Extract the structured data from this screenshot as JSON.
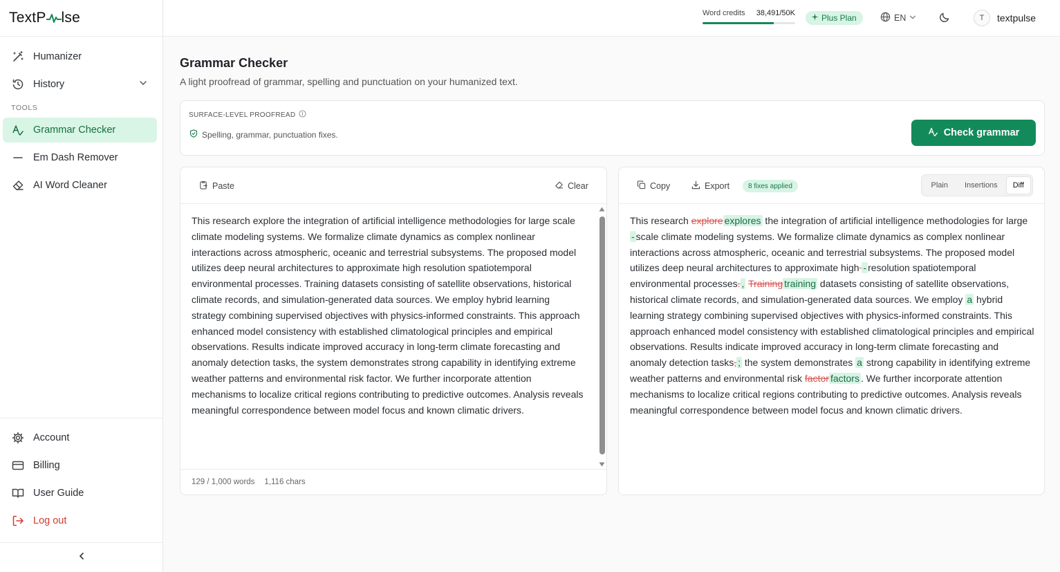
{
  "brand": {
    "name_prefix": "TextP",
    "name_suffix": "lse"
  },
  "sidebar": {
    "main_items": [
      {
        "label": "Humanizer"
      },
      {
        "label": "History"
      }
    ],
    "tools_label": "TOOLS",
    "tool_items": [
      {
        "label": "Grammar Checker",
        "active": true
      },
      {
        "label": "Em Dash Remover"
      },
      {
        "label": "AI Word Cleaner"
      }
    ],
    "bottom_items": [
      {
        "label": "Account"
      },
      {
        "label": "Billing"
      },
      {
        "label": "User Guide"
      },
      {
        "label": "Log out"
      }
    ]
  },
  "header": {
    "credits_label": "Word credits",
    "credits_value": "38,491/50K",
    "credits_fraction": 0.77,
    "plan": "Plus Plan",
    "language": "EN",
    "avatar_initial": "T",
    "username": "textpulse"
  },
  "page": {
    "title": "Grammar Checker",
    "subtitle": "A light proofread of grammar, spelling and punctuation on your humanized text."
  },
  "proof": {
    "label": "SURFACE-LEVEL PROOFREAD",
    "note": "Spelling, grammar, punctuation fixes.",
    "button": "Check grammar"
  },
  "input_panel": {
    "paste": "Paste",
    "clear": "Clear",
    "text": "This research explore the integration of artificial intelligence methodologies for large scale climate modeling systems. We formalize climate dynamics as complex nonlinear interactions across atmospheric, oceanic and terrestrial subsystems. The proposed model utilizes deep neural architectures to approximate high resolution spatiotemporal environmental processes. Training datasets consisting of satellite observations, historical climate records, and simulation-generated data sources. We employ hybrid learning strategy combining supervised objectives with physics-informed constraints. This approach enhanced model consistency with established climatological principles and empirical observations. Results indicate improved accuracy in long-term climate forecasting and anomaly detection tasks, the system demonstrates strong capability in identifying extreme weather patterns and environmental risk factor. We further incorporate attention mechanisms to localize critical regions contributing to predictive outcomes. Analysis reveals meaningful correspondence between model focus and known climatic drivers.",
    "word_count": "129 / 1,000 words",
    "char_count": "1,116 chars"
  },
  "output_panel": {
    "copy": "Copy",
    "export": "Export",
    "fixes_badge": "8 fixes applied",
    "views": [
      "Plain",
      "Insertions",
      "Diff"
    ],
    "active_view": "Diff",
    "segments": [
      {
        "t": "This research "
      },
      {
        "t": "explore",
        "type": "del"
      },
      {
        "t": "explores",
        "type": "ins"
      },
      {
        "t": " the integration of artificial intelligence methodologies for large"
      },
      {
        "t": " ",
        "type": "del"
      },
      {
        "t": "-",
        "type": "ins"
      },
      {
        "t": "scale climate modeling systems. We formalize climate dynamics as complex nonlinear interactions across atmospheric, oceanic and terrestrial subsystems. The proposed model utilizes deep neural architectures to approximate high"
      },
      {
        "t": " ",
        "type": "del"
      },
      {
        "t": "-",
        "type": "ins"
      },
      {
        "t": "resolution spatiotemporal environmental processes"
      },
      {
        "t": ".",
        "type": "del"
      },
      {
        "t": ",",
        "type": "ins"
      },
      {
        "t": " "
      },
      {
        "t": "Training",
        "type": "del"
      },
      {
        "t": "training",
        "type": "ins"
      },
      {
        "t": " datasets consisting of satellite observations, historical climate records, and simulation-generated data sources. We employ "
      },
      {
        "t": "a",
        "type": "ins"
      },
      {
        "t": " hybrid learning strategy combining supervised objectives with physics-informed constraints. This approach enhanced model consistency with established climatological principles and empirical observations. Results indicate improved accuracy in long-term climate forecasting and anomaly detection tasks"
      },
      {
        "t": ",",
        "type": "del"
      },
      {
        "t": ";",
        "type": "ins"
      },
      {
        "t": " the system demonstrates "
      },
      {
        "t": "a",
        "type": "ins"
      },
      {
        "t": " strong capability in identifying extreme weather patterns and environmental risk "
      },
      {
        "t": "factor",
        "type": "del"
      },
      {
        "t": "factors",
        "type": "ins"
      },
      {
        "t": ". We further incorporate attention mechanisms to localize critical regions contributing to predictive outcomes. Analysis reveals meaningful correspondence between model focus and known climatic drivers."
      }
    ]
  },
  "colors": {
    "accent": "#138a5a",
    "accent_light": "#d7f4e5",
    "danger": "#d23b2e"
  }
}
